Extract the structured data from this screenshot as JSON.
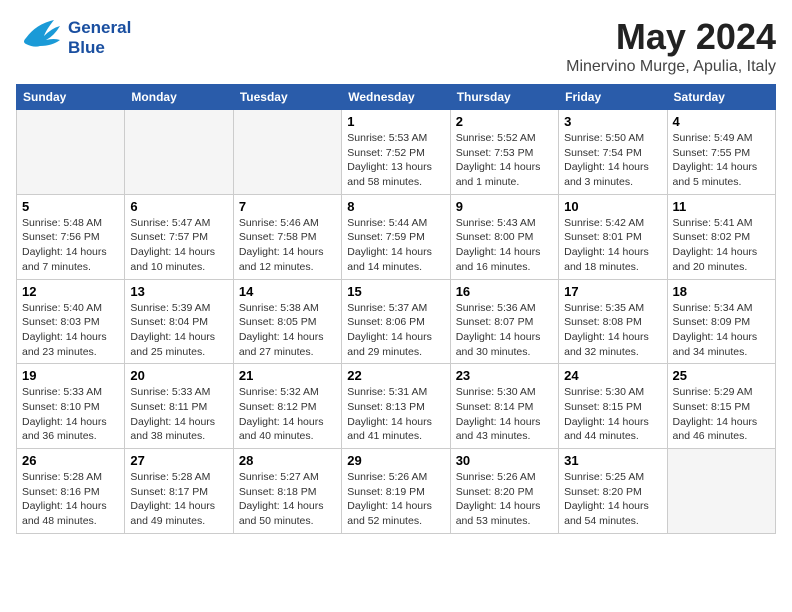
{
  "header": {
    "logo_line1": "General",
    "logo_line2": "Blue",
    "month_title": "May 2024",
    "location": "Minervino Murge, Apulia, Italy"
  },
  "days_of_week": [
    "Sunday",
    "Monday",
    "Tuesday",
    "Wednesday",
    "Thursday",
    "Friday",
    "Saturday"
  ],
  "weeks": [
    [
      {
        "day": "",
        "info": ""
      },
      {
        "day": "",
        "info": ""
      },
      {
        "day": "",
        "info": ""
      },
      {
        "day": "1",
        "info": "Sunrise: 5:53 AM\nSunset: 7:52 PM\nDaylight: 13 hours\nand 58 minutes."
      },
      {
        "day": "2",
        "info": "Sunrise: 5:52 AM\nSunset: 7:53 PM\nDaylight: 14 hours\nand 1 minute."
      },
      {
        "day": "3",
        "info": "Sunrise: 5:50 AM\nSunset: 7:54 PM\nDaylight: 14 hours\nand 3 minutes."
      },
      {
        "day": "4",
        "info": "Sunrise: 5:49 AM\nSunset: 7:55 PM\nDaylight: 14 hours\nand 5 minutes."
      }
    ],
    [
      {
        "day": "5",
        "info": "Sunrise: 5:48 AM\nSunset: 7:56 PM\nDaylight: 14 hours\nand 7 minutes."
      },
      {
        "day": "6",
        "info": "Sunrise: 5:47 AM\nSunset: 7:57 PM\nDaylight: 14 hours\nand 10 minutes."
      },
      {
        "day": "7",
        "info": "Sunrise: 5:46 AM\nSunset: 7:58 PM\nDaylight: 14 hours\nand 12 minutes."
      },
      {
        "day": "8",
        "info": "Sunrise: 5:44 AM\nSunset: 7:59 PM\nDaylight: 14 hours\nand 14 minutes."
      },
      {
        "day": "9",
        "info": "Sunrise: 5:43 AM\nSunset: 8:00 PM\nDaylight: 14 hours\nand 16 minutes."
      },
      {
        "day": "10",
        "info": "Sunrise: 5:42 AM\nSunset: 8:01 PM\nDaylight: 14 hours\nand 18 minutes."
      },
      {
        "day": "11",
        "info": "Sunrise: 5:41 AM\nSunset: 8:02 PM\nDaylight: 14 hours\nand 20 minutes."
      }
    ],
    [
      {
        "day": "12",
        "info": "Sunrise: 5:40 AM\nSunset: 8:03 PM\nDaylight: 14 hours\nand 23 minutes."
      },
      {
        "day": "13",
        "info": "Sunrise: 5:39 AM\nSunset: 8:04 PM\nDaylight: 14 hours\nand 25 minutes."
      },
      {
        "day": "14",
        "info": "Sunrise: 5:38 AM\nSunset: 8:05 PM\nDaylight: 14 hours\nand 27 minutes."
      },
      {
        "day": "15",
        "info": "Sunrise: 5:37 AM\nSunset: 8:06 PM\nDaylight: 14 hours\nand 29 minutes."
      },
      {
        "day": "16",
        "info": "Sunrise: 5:36 AM\nSunset: 8:07 PM\nDaylight: 14 hours\nand 30 minutes."
      },
      {
        "day": "17",
        "info": "Sunrise: 5:35 AM\nSunset: 8:08 PM\nDaylight: 14 hours\nand 32 minutes."
      },
      {
        "day": "18",
        "info": "Sunrise: 5:34 AM\nSunset: 8:09 PM\nDaylight: 14 hours\nand 34 minutes."
      }
    ],
    [
      {
        "day": "19",
        "info": "Sunrise: 5:33 AM\nSunset: 8:10 PM\nDaylight: 14 hours\nand 36 minutes."
      },
      {
        "day": "20",
        "info": "Sunrise: 5:33 AM\nSunset: 8:11 PM\nDaylight: 14 hours\nand 38 minutes."
      },
      {
        "day": "21",
        "info": "Sunrise: 5:32 AM\nSunset: 8:12 PM\nDaylight: 14 hours\nand 40 minutes."
      },
      {
        "day": "22",
        "info": "Sunrise: 5:31 AM\nSunset: 8:13 PM\nDaylight: 14 hours\nand 41 minutes."
      },
      {
        "day": "23",
        "info": "Sunrise: 5:30 AM\nSunset: 8:14 PM\nDaylight: 14 hours\nand 43 minutes."
      },
      {
        "day": "24",
        "info": "Sunrise: 5:30 AM\nSunset: 8:15 PM\nDaylight: 14 hours\nand 44 minutes."
      },
      {
        "day": "25",
        "info": "Sunrise: 5:29 AM\nSunset: 8:15 PM\nDaylight: 14 hours\nand 46 minutes."
      }
    ],
    [
      {
        "day": "26",
        "info": "Sunrise: 5:28 AM\nSunset: 8:16 PM\nDaylight: 14 hours\nand 48 minutes."
      },
      {
        "day": "27",
        "info": "Sunrise: 5:28 AM\nSunset: 8:17 PM\nDaylight: 14 hours\nand 49 minutes."
      },
      {
        "day": "28",
        "info": "Sunrise: 5:27 AM\nSunset: 8:18 PM\nDaylight: 14 hours\nand 50 minutes."
      },
      {
        "day": "29",
        "info": "Sunrise: 5:26 AM\nSunset: 8:19 PM\nDaylight: 14 hours\nand 52 minutes."
      },
      {
        "day": "30",
        "info": "Sunrise: 5:26 AM\nSunset: 8:20 PM\nDaylight: 14 hours\nand 53 minutes."
      },
      {
        "day": "31",
        "info": "Sunrise: 5:25 AM\nSunset: 8:20 PM\nDaylight: 14 hours\nand 54 minutes."
      },
      {
        "day": "",
        "info": ""
      }
    ]
  ]
}
